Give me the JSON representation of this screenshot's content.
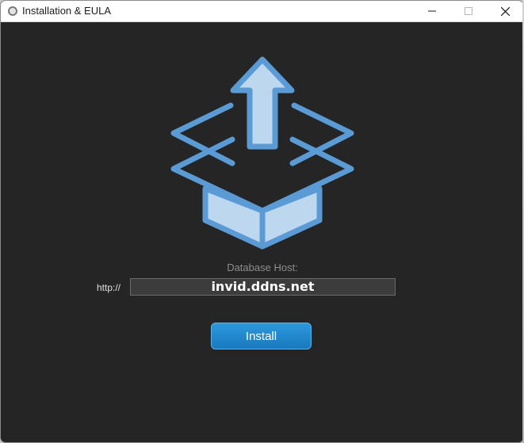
{
  "window": {
    "title": "Installation & EULA",
    "app_icon": "app-circle-icon",
    "controls": [
      "minimize-icon",
      "maximize-icon",
      "close-icon"
    ]
  },
  "content": {
    "hero_icon": "open-box-upload-icon",
    "database_host_label": "Database Host:",
    "url_prefix": "http://",
    "host_value": "invid.ddns.net",
    "install_label": "Install"
  },
  "colors": {
    "background": "#252526",
    "icon_stroke": "#5b9bd5",
    "icon_fill": "#bdd7ee",
    "button": "#1f87cc"
  }
}
